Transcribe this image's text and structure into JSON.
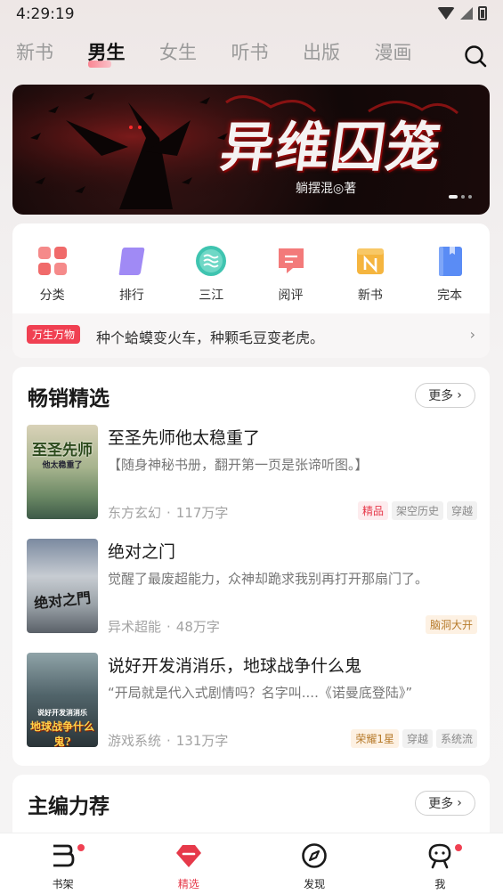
{
  "status_bar": {
    "time": "4:29:19"
  },
  "top_tabs": [
    {
      "label": "新书",
      "active": false
    },
    {
      "label": "男生",
      "active": true
    },
    {
      "label": "女生",
      "active": false
    },
    {
      "label": "听书",
      "active": false
    },
    {
      "label": "出版",
      "active": false
    },
    {
      "label": "漫画",
      "active": false
    }
  ],
  "banner": {
    "title": "异维囚笼",
    "author": "躺摆混◎著",
    "page_count": 3,
    "active_page": 1
  },
  "quick_nav": [
    {
      "label": "分类",
      "icon": "grid-icon",
      "color": "#f06a6a"
    },
    {
      "label": "排行",
      "icon": "rank-icon",
      "color": "#a08af5"
    },
    {
      "label": "三江",
      "icon": "sanjiang-icon",
      "color": "#3fc4b0"
    },
    {
      "label": "阅评",
      "icon": "review-icon",
      "color": "#f26b6b"
    },
    {
      "label": "新书",
      "icon": "new-book-icon",
      "color": "#f5b53f"
    },
    {
      "label": "完本",
      "icon": "finished-book-icon",
      "color": "#5a8cf5"
    }
  ],
  "announcement": {
    "tag": "万生万物",
    "text": "种个蛤蟆变火车，种颗毛豆变老虎。"
  },
  "bestseller": {
    "title": "畅销精选",
    "more_label": "更多",
    "books": [
      {
        "title": "至圣先师他太稳重了",
        "description": "【随身神秘书册，翻开第一页是张谛听图。】",
        "genre": "东方玄幻",
        "words": "117万字",
        "tags": [
          {
            "label": "精品",
            "style": "red"
          },
          {
            "label": "架空历史",
            "style": "gray"
          },
          {
            "label": "穿越",
            "style": "gray"
          }
        ],
        "cover_text": "至圣先师",
        "cover_subtitle": "他太稳重了"
      },
      {
        "title": "绝对之门",
        "description": "觉醒了最废超能力，众神却跪求我别再打开那扇门了。",
        "genre": "异术超能",
        "words": "48万字",
        "tags": [
          {
            "label": "脑洞大开",
            "style": "gold"
          }
        ],
        "cover_text": "绝对之門"
      },
      {
        "title": "说好开发消消乐，地球战争什么鬼",
        "description": "“开局就是代入式剧情吗？名字叫....《诺曼底登陆》”",
        "genre": "游戏系统",
        "words": "131万字",
        "tags": [
          {
            "label": "荣耀1星",
            "style": "gold"
          },
          {
            "label": "穿越",
            "style": "gray"
          },
          {
            "label": "系统流",
            "style": "gray"
          }
        ],
        "cover_text": "地球战争什么鬼?",
        "cover_subtitle": "说好开发消消乐"
      }
    ]
  },
  "editor_picks": {
    "title": "主编力荐",
    "more_label": "更多"
  },
  "bottom_nav": [
    {
      "label": "书架",
      "icon": "bookshelf-icon",
      "active": false,
      "badge": true
    },
    {
      "label": "精选",
      "icon": "featured-icon",
      "active": true,
      "badge": false
    },
    {
      "label": "发现",
      "icon": "compass-icon",
      "active": false,
      "badge": false
    },
    {
      "label": "我",
      "icon": "profile-icon",
      "active": false,
      "badge": true
    }
  ],
  "colors": {
    "accent": "#e6394a",
    "tag_red_bg": "#fdecee",
    "tag_gold_bg": "#fdf1e3"
  }
}
